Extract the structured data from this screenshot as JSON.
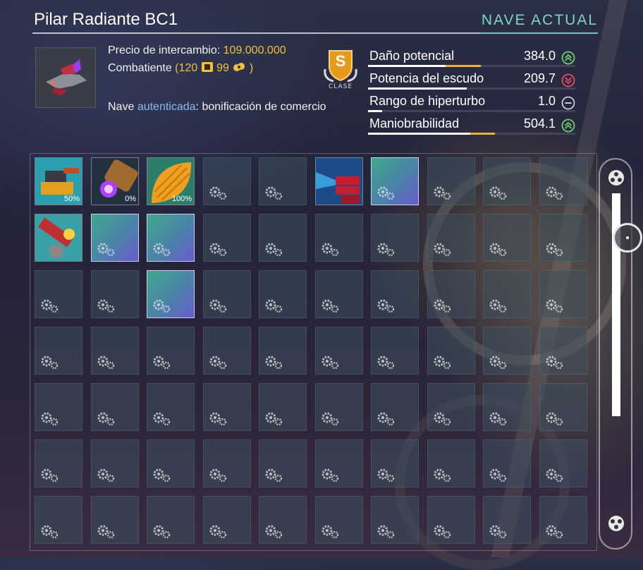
{
  "header": {
    "title": "Pilar Radiante BC1",
    "ship_status": "NAVE ACTUAL"
  },
  "ship_info": {
    "price_label": "Precio de intercambio:",
    "price_value": "109.000.000",
    "type_label": "Combatiente",
    "type_paren_open": "(120",
    "type_num2": "99",
    "type_paren_close": ")",
    "auth_prefix": "Nave",
    "auth_word": "autenticada",
    "auth_suffix": ": bonificación de comercio",
    "class_letter": "S",
    "class_label": "CLASE"
  },
  "stats": [
    {
      "label": "Daño potencial",
      "value": "384.0",
      "trend": "up",
      "fill_white": 0.37,
      "fill_gold": 0.17
    },
    {
      "label": "Potencia del escudo",
      "value": "209.7",
      "trend": "down",
      "fill_white": 0.47,
      "fill_gold": 0.0
    },
    {
      "label": "Rango de hiperturbo",
      "value": "1.0",
      "trend": "neutral",
      "fill_white": 0.07,
      "fill_gold": 0.0
    },
    {
      "label": "Maniobrabilidad",
      "value": "504.1",
      "trend": "up",
      "fill_white": 0.49,
      "fill_gold": 0.1
    }
  ],
  "colors": {
    "accent_teal": "#7fd3c4",
    "gold": "#f0c040",
    "up_green": "#6fd06f",
    "down_red": "#e05060"
  },
  "inventory": {
    "tech_slots": [
      {
        "charge": "50%"
      },
      {
        "charge": "0%"
      },
      {
        "charge": "100%"
      },
      {
        "charge": ""
      },
      {
        "charge": ""
      }
    ]
  }
}
